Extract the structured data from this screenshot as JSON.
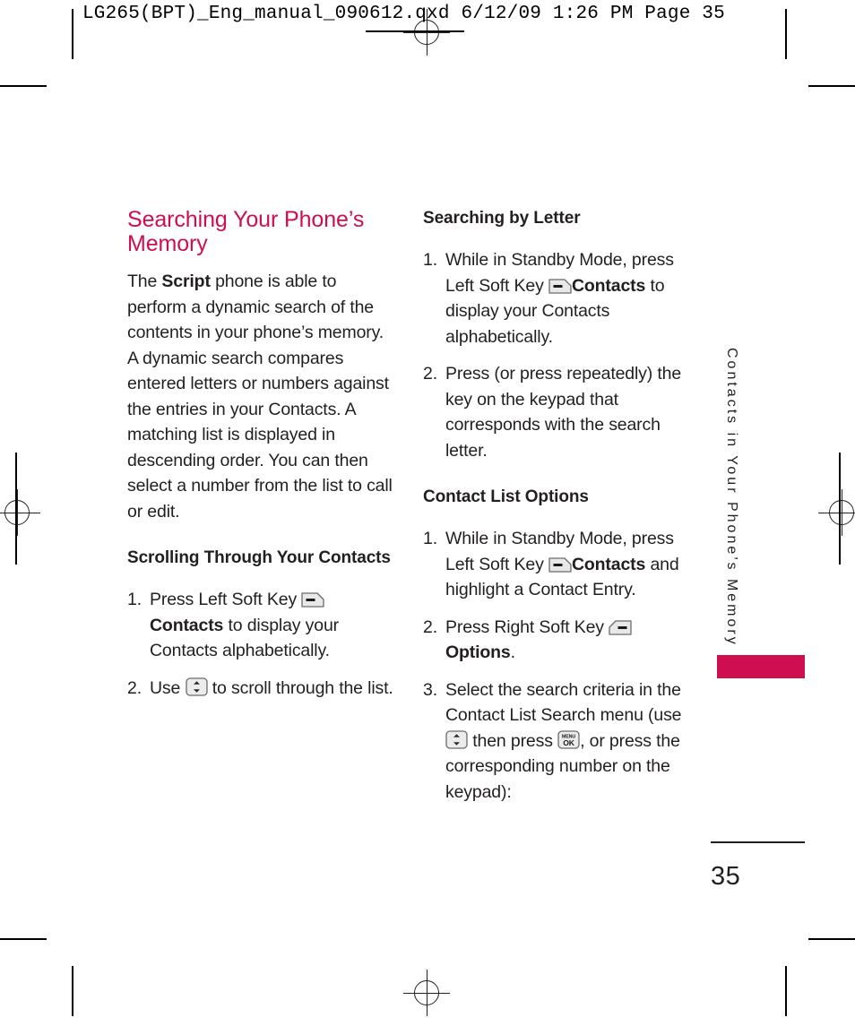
{
  "print_slug": {
    "text": "LG265(BPT)_Eng_manual_090612.qxd   6/12/09   1:26 PM   Page 35"
  },
  "left_column": {
    "section_title": "Searching Your Phone’s Memory",
    "intro": {
      "before_bold": "The ",
      "bold": "Script",
      "after_bold": " phone is able to perform a dynamic search of the contents in your phone’s memory. A dynamic search compares entered letters or numbers against the entries in your Contacts. A matching list is displayed in descending order. You can then select a number from the list to call or edit."
    },
    "subsection_title": "Scrolling Through Your Contacts",
    "steps": [
      {
        "number": "1.",
        "part_a": "Press Left Soft Key ",
        "icon": "left-soft-key-icon",
        "bold": "Contacts",
        "part_b": " to display your Contacts alphabetically."
      },
      {
        "number": "2.",
        "part_a": "Use ",
        "icon": "navigation-key-icon",
        "part_b": " to scroll through the list."
      }
    ]
  },
  "right_column": {
    "subsection_1_title": "Searching by Letter",
    "subsection_1_steps": [
      {
        "number": "1.",
        "part_a": "While in Standby Mode, press Left Soft Key ",
        "icon": "left-soft-key-icon",
        "bold": "Contacts",
        "part_b": " to display your Contacts alphabetically."
      },
      {
        "number": "2.",
        "part_a": "Press (or press repeatedly) the key on the keypad that corresponds with the search letter."
      }
    ],
    "subsection_2_title": "Contact List Options",
    "subsection_2_steps": [
      {
        "number": "1.",
        "part_a": "While in Standby Mode, press Left Soft Key ",
        "icon": "left-soft-key-icon",
        "bold": "Contacts",
        "part_b": " and highlight a Contact Entry."
      },
      {
        "number": "2.",
        "part_a": "Press Right Soft Key ",
        "icon": "right-soft-key-icon",
        "bold2": "Options",
        "part_b": "."
      },
      {
        "number": "3.",
        "part_a": "Select the search criteria in the Contact List Search menu (use ",
        "icon": "navigation-key-icon",
        "part_b": " then press ",
        "icon2": "menu-ok-key-icon",
        "part_c": ", or press the corresponding number on the keypad):"
      }
    ]
  },
  "side_tab": {
    "label": "Contacts in Your Phone’s Memory"
  },
  "folio": {
    "page_number": "35"
  },
  "key_icons": {
    "menu_ok_top": "MENU",
    "menu_ok_bottom": "OK"
  },
  "colors": {
    "accent": "#ce0e50",
    "text": "#231f20",
    "key_fill": "#e8e8e8",
    "key_stroke": "#5a5a5a"
  }
}
